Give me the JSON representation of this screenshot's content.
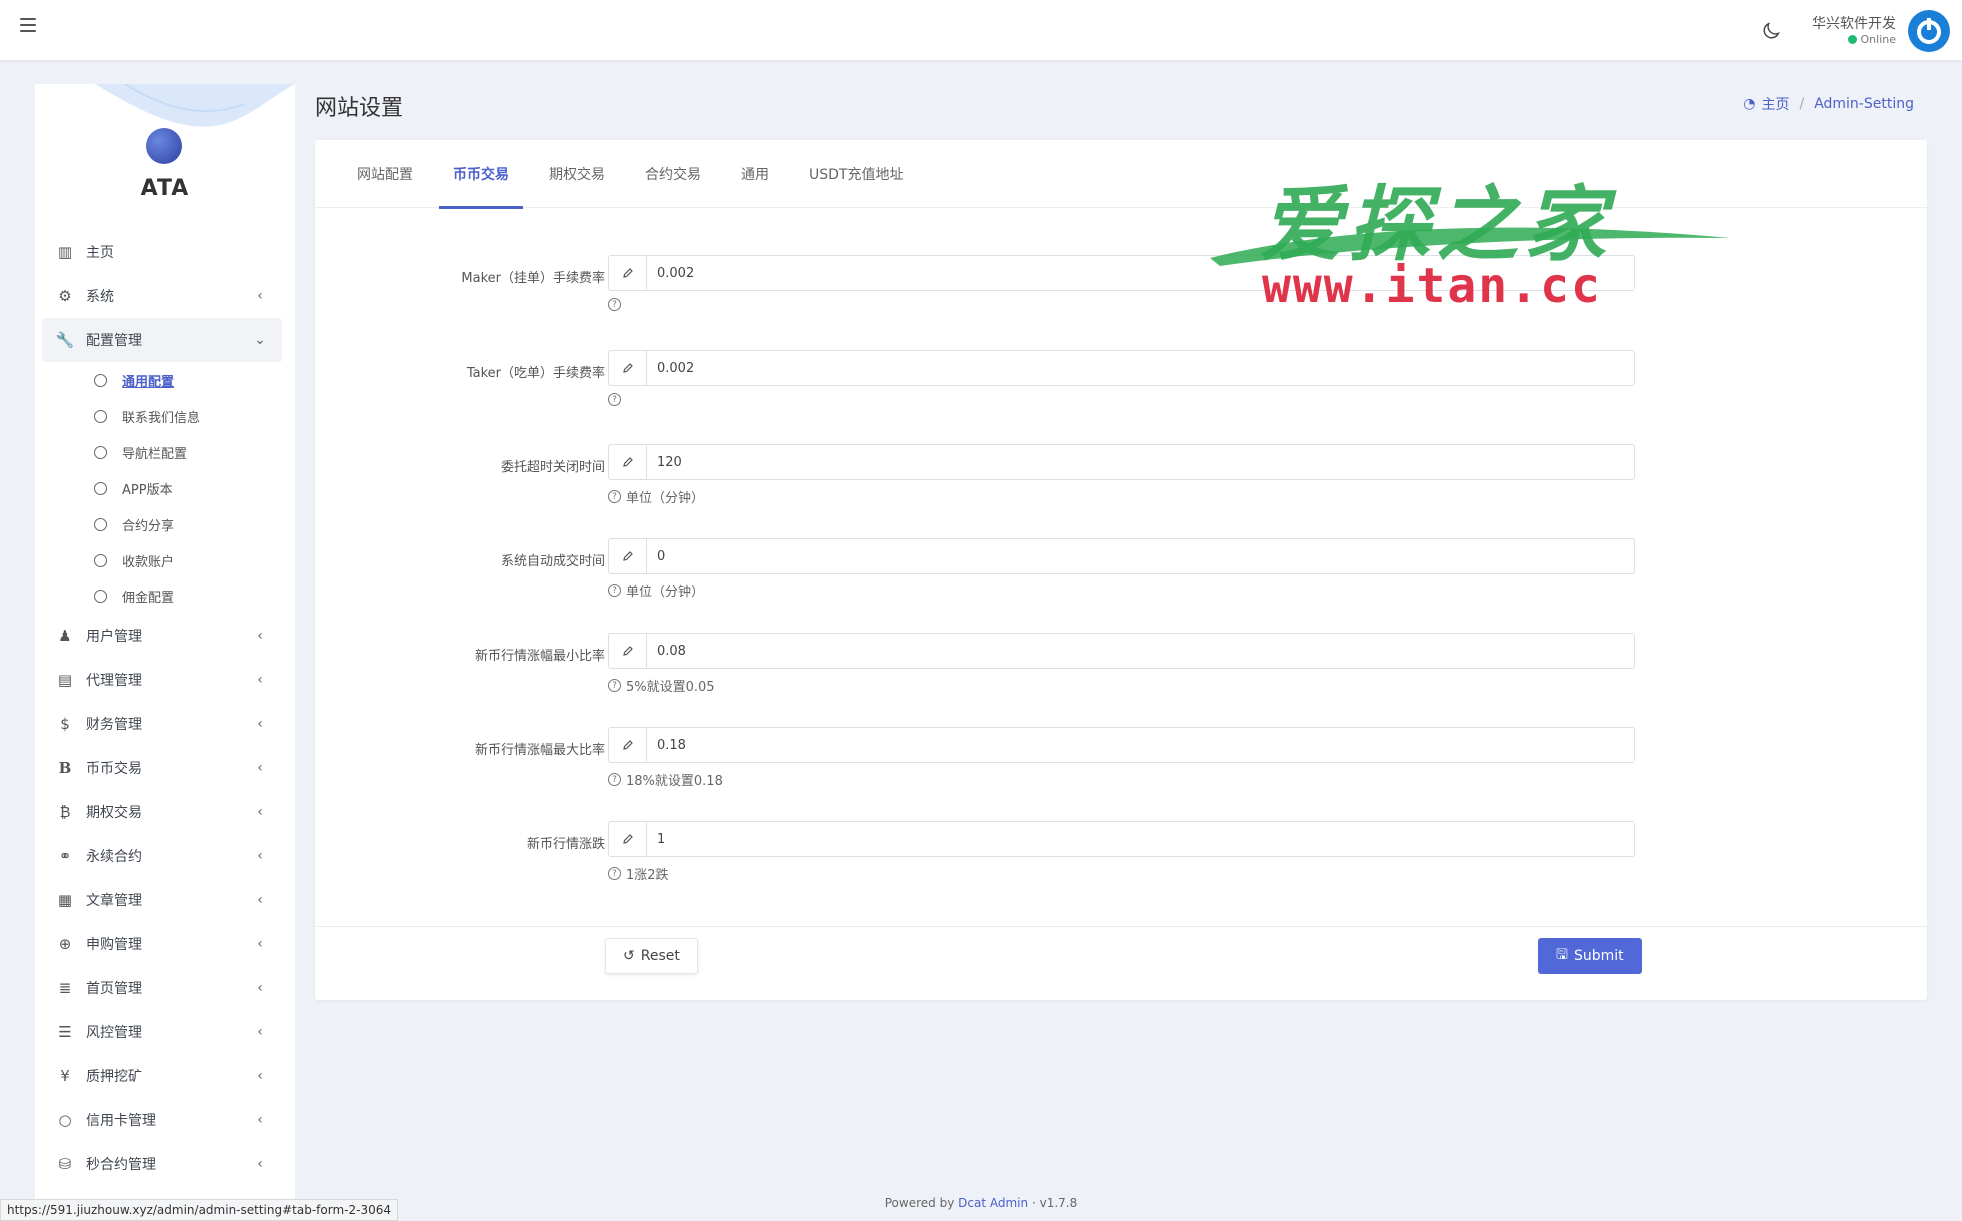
{
  "topbar": {
    "user_name": "华兴软件开发",
    "user_status": "Online",
    "colors": {
      "status": "#21b978",
      "avatar": "#1a7fd6"
    }
  },
  "sidebar": {
    "brand": "ATA",
    "menu": [
      {
        "label": "主页",
        "icon": "chart-bar-icon"
      },
      {
        "label": "系统",
        "icon": "gear-icon"
      },
      {
        "label": "配置管理",
        "icon": "wrench-icon"
      },
      {
        "label": "用户管理",
        "icon": "users-icon"
      },
      {
        "label": "代理管理",
        "icon": "id-card-icon"
      },
      {
        "label": "财务管理",
        "icon": "dollar-icon"
      },
      {
        "label": "币币交易",
        "icon": "b-letter-icon"
      },
      {
        "label": "期权交易",
        "icon": "bitcoin-icon"
      },
      {
        "label": "永续合约",
        "icon": "link-icon"
      },
      {
        "label": "文章管理",
        "icon": "newspaper-icon"
      },
      {
        "label": "申购管理",
        "icon": "lifebuoy-icon"
      },
      {
        "label": "首页管理",
        "icon": "list-icon"
      },
      {
        "label": "风控管理",
        "icon": "indent-icon"
      },
      {
        "label": "质押挖矿",
        "icon": "yen-icon"
      },
      {
        "label": "信用卡管理",
        "icon": "circle-icon"
      },
      {
        "label": "秒合约管理",
        "icon": "coins-icon"
      }
    ],
    "submenu": [
      {
        "label": "通用配置"
      },
      {
        "label": "联系我们信息"
      },
      {
        "label": "导航栏配置"
      },
      {
        "label": "APP版本"
      },
      {
        "label": "合约分享"
      },
      {
        "label": "收款账户"
      },
      {
        "label": "佣金配置"
      }
    ]
  },
  "header": {
    "title": "网站设置",
    "breadcrumb_home": "主页",
    "breadcrumb_current": "Admin-Setting"
  },
  "tabs": [
    {
      "label": "网站配置"
    },
    {
      "label": "币币交易"
    },
    {
      "label": "期权交易"
    },
    {
      "label": "合约交易"
    },
    {
      "label": "通用"
    },
    {
      "label": "USDT充值地址"
    }
  ],
  "form": {
    "fields": [
      {
        "label": "Maker（挂单）手续费率",
        "value": "0.002",
        "help": ""
      },
      {
        "label": "Taker（吃单）手续费率",
        "value": "0.002",
        "help": ""
      },
      {
        "label": "委托超时关闭时间",
        "value": "120",
        "help": "单位（分钟）"
      },
      {
        "label": "系统自动成交时间",
        "value": "0",
        "help": "单位（分钟）"
      },
      {
        "label": "新币行情涨幅最小比率",
        "value": "0.08",
        "help": "5%就设置0.05"
      },
      {
        "label": "新币行情涨幅最大比率",
        "value": "0.18",
        "help": "18%就设置0.18"
      },
      {
        "label": "新币行情涨跌",
        "value": "1",
        "help": "1涨2跌"
      }
    ],
    "reset_label": "Reset",
    "submit_label": "Submit"
  },
  "watermark": {
    "cn": "爱探之家",
    "url": "www.itan.cc"
  },
  "footer": {
    "prefix": "Powered by",
    "link": "Dcat Admin",
    "version": "v1.7.8"
  },
  "status_url": "https://591.jiuzhouw.xyz/admin/admin-setting#tab-form-2-3064",
  "colors": {
    "accent": "#4c60c9",
    "primary_button": "#5168d8"
  }
}
